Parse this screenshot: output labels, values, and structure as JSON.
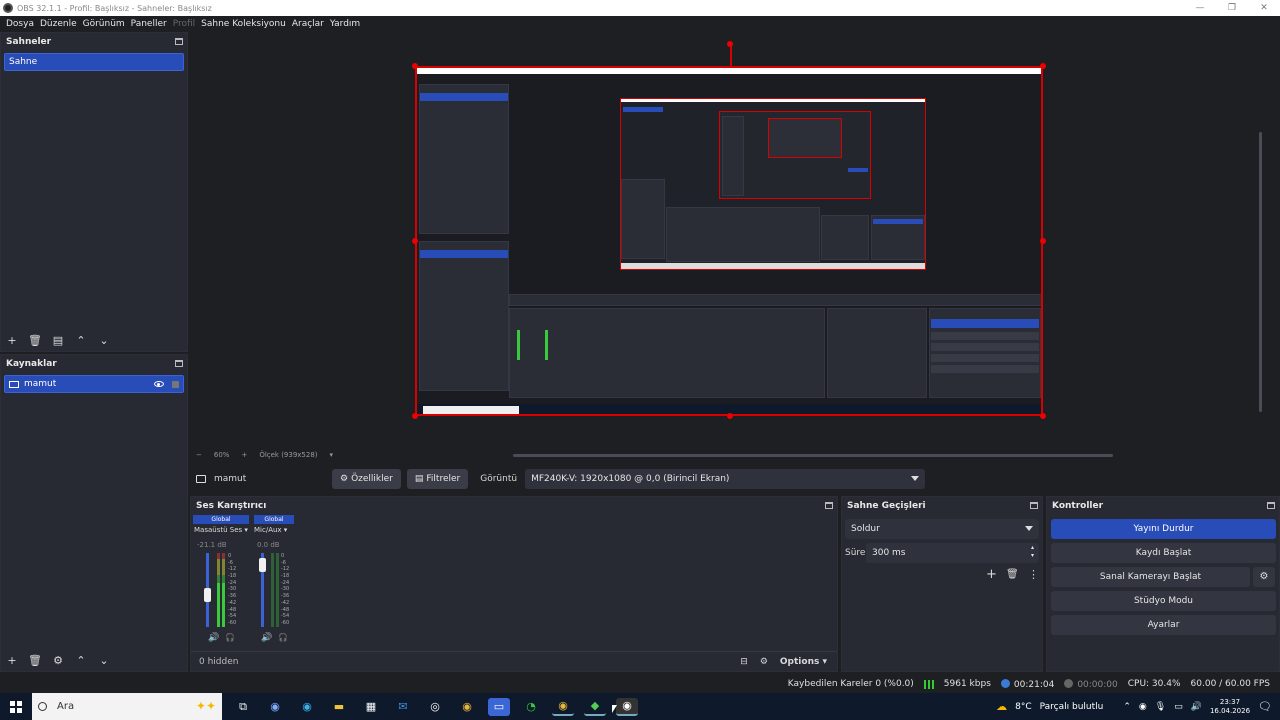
{
  "window": {
    "title": "OBS 32.1.1 - Profil: Başlıksız - Sahneler: Başlıksız"
  },
  "menu": {
    "items": [
      "Dosya",
      "Düzenle",
      "Görünüm",
      "Paneller",
      "Profil",
      "Sahne Koleksiyonu",
      "Araçlar",
      "Yardım"
    ]
  },
  "scenes": {
    "title": "Sahneler",
    "items": [
      "Sahne"
    ]
  },
  "sources": {
    "title": "Kaynaklar",
    "items": [
      "mamut"
    ]
  },
  "preview": {
    "zoom": "60%",
    "scale_label": "Ölçek (939x528)"
  },
  "source_bar": {
    "name": "mamut",
    "properties": "Özellikler",
    "filters": "Filtreler",
    "display_label": "Görüntü",
    "display_value": "MF240K-V: 1920x1080 @ 0,0 (Birincil Ekran)"
  },
  "mixer": {
    "title": "Ses Karıştırıcı",
    "channels": [
      {
        "tag": "Global",
        "name": "Masaüstü Ses",
        "db": "-21.1 dB",
        "level": 0.42
      },
      {
        "tag": "Global",
        "name": "Mic/Aux",
        "db": "0.0 dB",
        "level": 0.92
      }
    ],
    "scale": [
      "0",
      "-6",
      "-12",
      "-18",
      "-24",
      "-30",
      "-36",
      "-42",
      "-48",
      "-54",
      "-60"
    ],
    "hidden": "0 hidden",
    "options": "Options"
  },
  "transitions": {
    "title": "Sahne Geçişleri",
    "selected": "Soldur",
    "duration_label": "Süre",
    "duration_value": "300 ms"
  },
  "controls": {
    "title": "Kontroller",
    "buttons": [
      "Yayını Durdur",
      "Kaydı Başlat",
      "Sanal Kamerayı Başlat",
      "Stüdyo Modu",
      "Ayarlar"
    ]
  },
  "status": {
    "dropped": "Kaybedilen Kareler 0 (%0.0)",
    "bitrate": "5961 kbps",
    "stream_time": "00:21:04",
    "rec_time": "00:00:00",
    "cpu": "CPU: 30.4%",
    "fps": "60.00 / 60.00 FPS"
  },
  "taskbar": {
    "search": "Ara",
    "weather": "8°C",
    "weather_desc": "Parçalı bulutlu",
    "time": "23:37",
    "date": "16.04.2026"
  },
  "colors": {
    "accent": "#284cb8",
    "red": "#d90000",
    "meter_green": "#3cc83c"
  }
}
